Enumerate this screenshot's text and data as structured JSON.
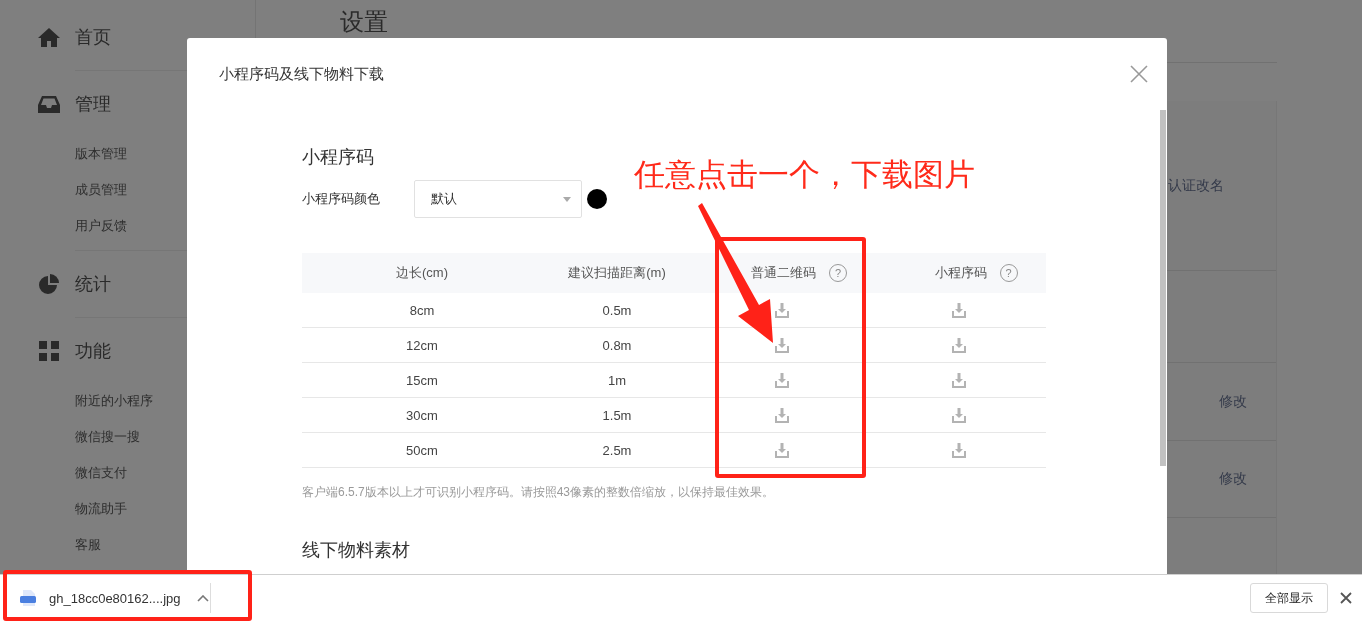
{
  "sidebar": {
    "groups": [
      {
        "kind": "home",
        "label": "首页"
      },
      {
        "kind": "inbox",
        "label": "管理",
        "items": [
          "版本管理",
          "成员管理",
          "用户反馈"
        ]
      },
      {
        "kind": "stats",
        "label": "统计"
      },
      {
        "kind": "features",
        "label": "功能",
        "items": [
          "附近的小程序",
          "微信搜一搜",
          "微信支付",
          "物流助手",
          "客服"
        ]
      }
    ]
  },
  "background_page": {
    "title": "设置",
    "fragment": "认证改名",
    "actions": [
      "修改",
      "修改"
    ]
  },
  "dialog": {
    "title": "小程序码及线下物料下载",
    "section_1": {
      "heading": "小程序码",
      "color_label": "小程序码颜色",
      "color_select": {
        "value": "默认",
        "color": "#000000"
      },
      "table": {
        "columns": [
          {
            "label": "边长(cm)"
          },
          {
            "label": "建议扫描距离(m)"
          },
          {
            "label": "普通二维码",
            "help": "?"
          },
          {
            "label": "小程序码",
            "help": "?"
          }
        ],
        "rows": [
          {
            "size": "8cm",
            "distance": "0.5m"
          },
          {
            "size": "12cm",
            "distance": "0.8m"
          },
          {
            "size": "15cm",
            "distance": "1m"
          },
          {
            "size": "30cm",
            "distance": "1.5m"
          },
          {
            "size": "50cm",
            "distance": "2.5m"
          }
        ]
      },
      "note": "客户端6.5.7版本以上才可识别小程序码。请按照43像素的整数倍缩放，以保持最佳效果。"
    },
    "section_2": {
      "heading": "线下物料素材"
    }
  },
  "annotation": {
    "callout": "任意点击一个，下载图片"
  },
  "download_bar": {
    "file": "gh_18cc0e80162....jpg",
    "show_all": "全部显示"
  }
}
